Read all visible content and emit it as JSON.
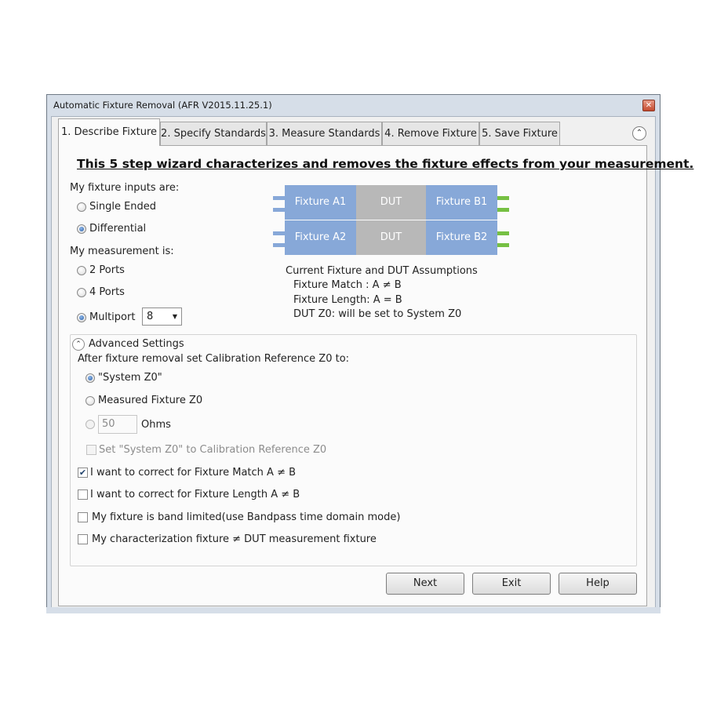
{
  "window": {
    "title": "Automatic Fixture Removal (AFR V2015.11.25.1)",
    "close_glyph": "✕"
  },
  "tabs": [
    {
      "label": "1. Describe Fixture",
      "active": true
    },
    {
      "label": "2. Specify Standards",
      "active": false
    },
    {
      "label": "3. Measure Standards",
      "active": false
    },
    {
      "label": "4. Remove Fixture",
      "active": false
    },
    {
      "label": "5. Save Fixture",
      "active": false
    }
  ],
  "collapse_glyph": "⌃",
  "heading": "This 5 step wizard characterizes and removes the fixture effects from your measurement.",
  "fixture_inputs": {
    "label": "My fixture inputs are:",
    "options": [
      {
        "label": "Single Ended",
        "checked": false
      },
      {
        "label": "Differential",
        "checked": true
      }
    ]
  },
  "measurement": {
    "label": "My measurement is:",
    "options": [
      {
        "label": "2 Ports",
        "checked": false
      },
      {
        "label": "4 Ports",
        "checked": false
      },
      {
        "label": "Multiport",
        "checked": true
      }
    ],
    "multiport_value": "8",
    "dropdown_glyph": "▼"
  },
  "diagram": {
    "row1": [
      "Fixture A1",
      "DUT",
      "Fixture B1"
    ],
    "row2": [
      "Fixture A2",
      "DUT",
      "Fixture B2"
    ],
    "colors": {
      "fixture": "#87a8d8",
      "dut": "#b8b8b8",
      "left_pin": "#87a8d8",
      "right_pin": "#76c043"
    }
  },
  "assumptions": {
    "title": "Current Fixture and DUT Assumptions",
    "lines": [
      "Fixture Match : A ≠ B",
      "Fixture Length: A = B",
      "DUT Z0: will be set to System Z0"
    ]
  },
  "advanced": {
    "toggle_glyph": "⌃",
    "label": "Advanced Settings",
    "z0_prompt": "After fixture removal set Calibration Reference Z0 to:",
    "z0_options": [
      {
        "label": "\"System Z0\"",
        "checked": true,
        "disabled": false
      },
      {
        "label": "Measured Fixture Z0",
        "checked": false,
        "disabled": false
      },
      {
        "label": "",
        "checked": false,
        "disabled": true
      }
    ],
    "ohms_value": "50",
    "ohms_unit": "Ohms",
    "set_system_z0": {
      "label": "Set \"System Z0\" to Calibration Reference Z0",
      "checked": false,
      "disabled": true
    },
    "checks": [
      {
        "label": "I want to correct for Fixture Match A ≠ B",
        "checked": true
      },
      {
        "label": "I want to correct for Fixture Length A ≠ B",
        "checked": false
      },
      {
        "label": "My fixture is band limited(use Bandpass time domain mode)",
        "checked": false
      },
      {
        "label": "My characterization fixture ≠ DUT measurement fixture",
        "checked": false
      }
    ],
    "check_glyph": "✔"
  },
  "buttons": {
    "next": "Next",
    "exit": "Exit",
    "help": "Help"
  }
}
